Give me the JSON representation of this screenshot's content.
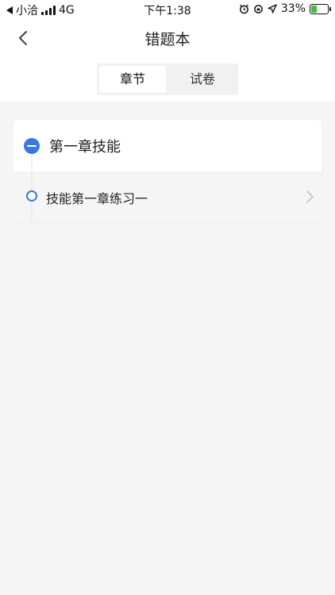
{
  "status_bar": {
    "carrier": "小洽",
    "network": "4G",
    "time": "下午1:38",
    "battery": "33%",
    "icons": [
      "back-triangle-icon",
      "signal-icon",
      "alarm-icon",
      "location-icon",
      "battery-icon"
    ]
  },
  "nav": {
    "title": "错题本",
    "back_icon": "chevron-left-icon"
  },
  "tabs": [
    {
      "label": "章节",
      "active": true
    },
    {
      "label": "试卷",
      "active": false
    }
  ],
  "chapters": [
    {
      "label": "第一章技能",
      "icon": "collapse-minus-icon",
      "items": [
        {
          "label": "技能第一章练习一",
          "icon": "ring-icon",
          "arrow": "chevron-right-icon"
        }
      ]
    }
  ],
  "colors": {
    "accent": "#3a78e0",
    "background": "#f5f5f5",
    "card": "#ffffff",
    "battery": "#3cc13b"
  }
}
